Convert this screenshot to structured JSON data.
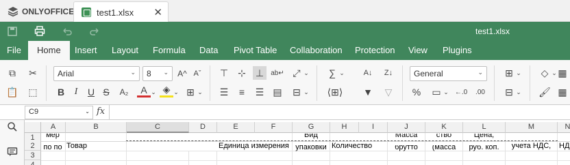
{
  "app": {
    "logo_text": "ONLYOFFICE"
  },
  "tab": {
    "filename": "test1.xlsx",
    "close_glyph": "✕"
  },
  "title": "test1.xlsx",
  "menu": [
    "File",
    "Home",
    "Insert",
    "Layout",
    "Formula",
    "Data",
    "Pivot Table",
    "Collaboration",
    "Protection",
    "View",
    "Plugins"
  ],
  "toolbar": {
    "font_name": "Arial",
    "font_size": "8",
    "number_format": "General",
    "bold": "B",
    "italic": "I",
    "underline": "U",
    "strike": "S",
    "subscript": "A₂",
    "font_color": "A",
    "percent": "%",
    "increase_font": "A^",
    "decrease_font": "Aˇ"
  },
  "formula_bar": {
    "cell_ref": "C9",
    "fx": "fx",
    "content": ""
  },
  "grid": {
    "columns": [
      "A",
      "B",
      "C",
      "D",
      "E",
      "F",
      "G",
      "H",
      "I",
      "J",
      "K",
      "L",
      "M",
      "N"
    ],
    "rows": [
      "1",
      "2",
      "3",
      "4"
    ],
    "row2": {
      "A": "по по",
      "A_top": "мер",
      "B": "Товар",
      "E": "Единица измерения",
      "G": "упаковки",
      "G_top": "Вид",
      "H": "Количество",
      "J": "брутто",
      "J_top": "Масса",
      "K": "(масса",
      "K_top": "ство",
      "L": "руб. коп.",
      "L_top": "Цена,",
      "M": "учета НДС,",
      "N": "НД"
    }
  },
  "colors": {
    "brand_green": "#40865c",
    "toolbar_bg": "#f7f7f7"
  }
}
